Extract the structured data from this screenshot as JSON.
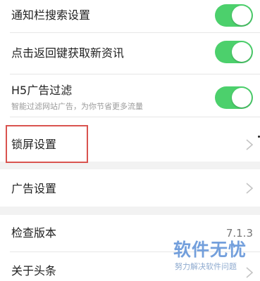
{
  "settings": {
    "notify_search": {
      "label": "通知栏搜索设置",
      "toggle_on": true
    },
    "back_refresh": {
      "label": "点击返回键获取新资讯",
      "toggle_on": true
    },
    "h5_ad_filter": {
      "label": "H5广告过滤",
      "sub": "智能过滤网站广告，为你节省更多流量",
      "toggle_on": true
    },
    "lock_screen": {
      "label": "锁屏设置"
    },
    "ad_settings": {
      "label": "广告设置"
    },
    "check_version": {
      "label": "检查版本",
      "value": "7.1.3"
    },
    "about": {
      "label": "关于头条"
    }
  },
  "watermark": {
    "title": "软件无忧",
    "subtitle": "努力解决软件问题"
  },
  "colors": {
    "toggle_on": "#4cd06c",
    "highlight": "#d9534f",
    "watermark": "#5b8fd6"
  },
  "icons": {
    "chevron": "chevron-right-icon"
  }
}
